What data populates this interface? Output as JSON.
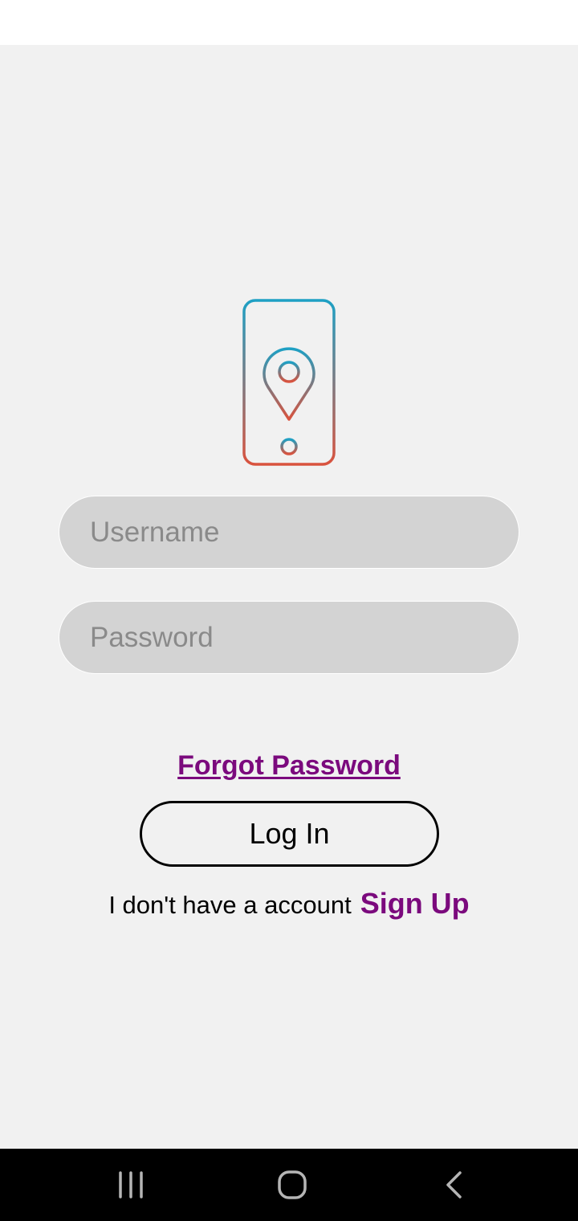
{
  "form": {
    "username_placeholder": "Username",
    "password_placeholder": "Password",
    "forgot_password": "Forgot Password",
    "login_label": "Log In",
    "signup_prompt": "I don't have a account",
    "signup_label": "Sign Up"
  },
  "logo": {
    "icon": "phone-location-pin-icon",
    "gradient_top": "#1ea0c4",
    "gradient_bottom": "#d9533e"
  },
  "colors": {
    "accent": "#7b0a7d",
    "background": "#f1f1f1",
    "field": "#d3d3d3"
  },
  "navigation": {
    "recents_icon": "recents-icon",
    "home_icon": "home-icon",
    "back_icon": "back-icon"
  }
}
